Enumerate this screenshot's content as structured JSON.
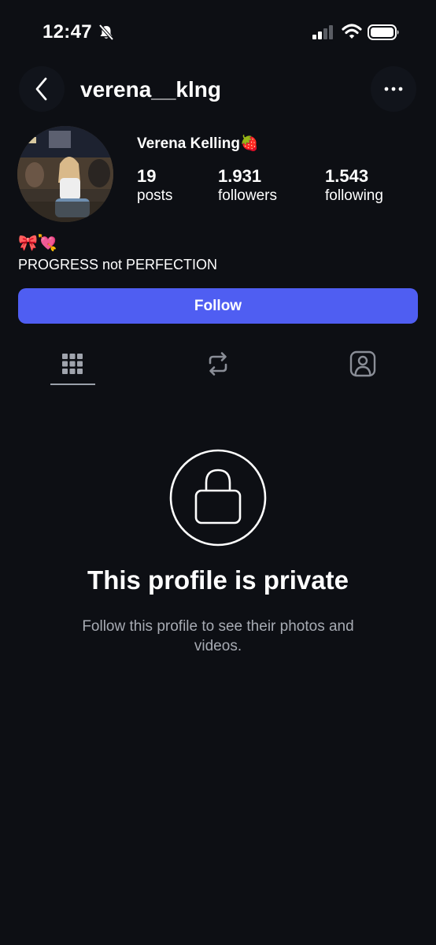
{
  "status_bar": {
    "time": "12:47"
  },
  "header": {
    "username": "verena__klng"
  },
  "profile": {
    "display_name": "Verena Kelling🍓",
    "stats": {
      "posts": {
        "value": "19",
        "label": "posts"
      },
      "followers": {
        "value": "1.931",
        "label": "followers"
      },
      "following": {
        "value": "1.543",
        "label": "following"
      }
    },
    "bio_emoji": "🎀💘",
    "bio_text": "PROGRESS not PERFECTION"
  },
  "actions": {
    "follow_label": "Follow"
  },
  "tabs": [
    {
      "icon": "grid-icon",
      "selected": true
    },
    {
      "icon": "repost-icon",
      "selected": false
    },
    {
      "icon": "tagged-person-icon",
      "selected": false
    }
  ],
  "private_notice": {
    "title": "This profile is private",
    "subtitle": "Follow this profile to see their photos and videos."
  },
  "colors": {
    "background": "#0d0f14",
    "accent": "#4f5ef2",
    "secondary_text": "#a7abb3"
  }
}
